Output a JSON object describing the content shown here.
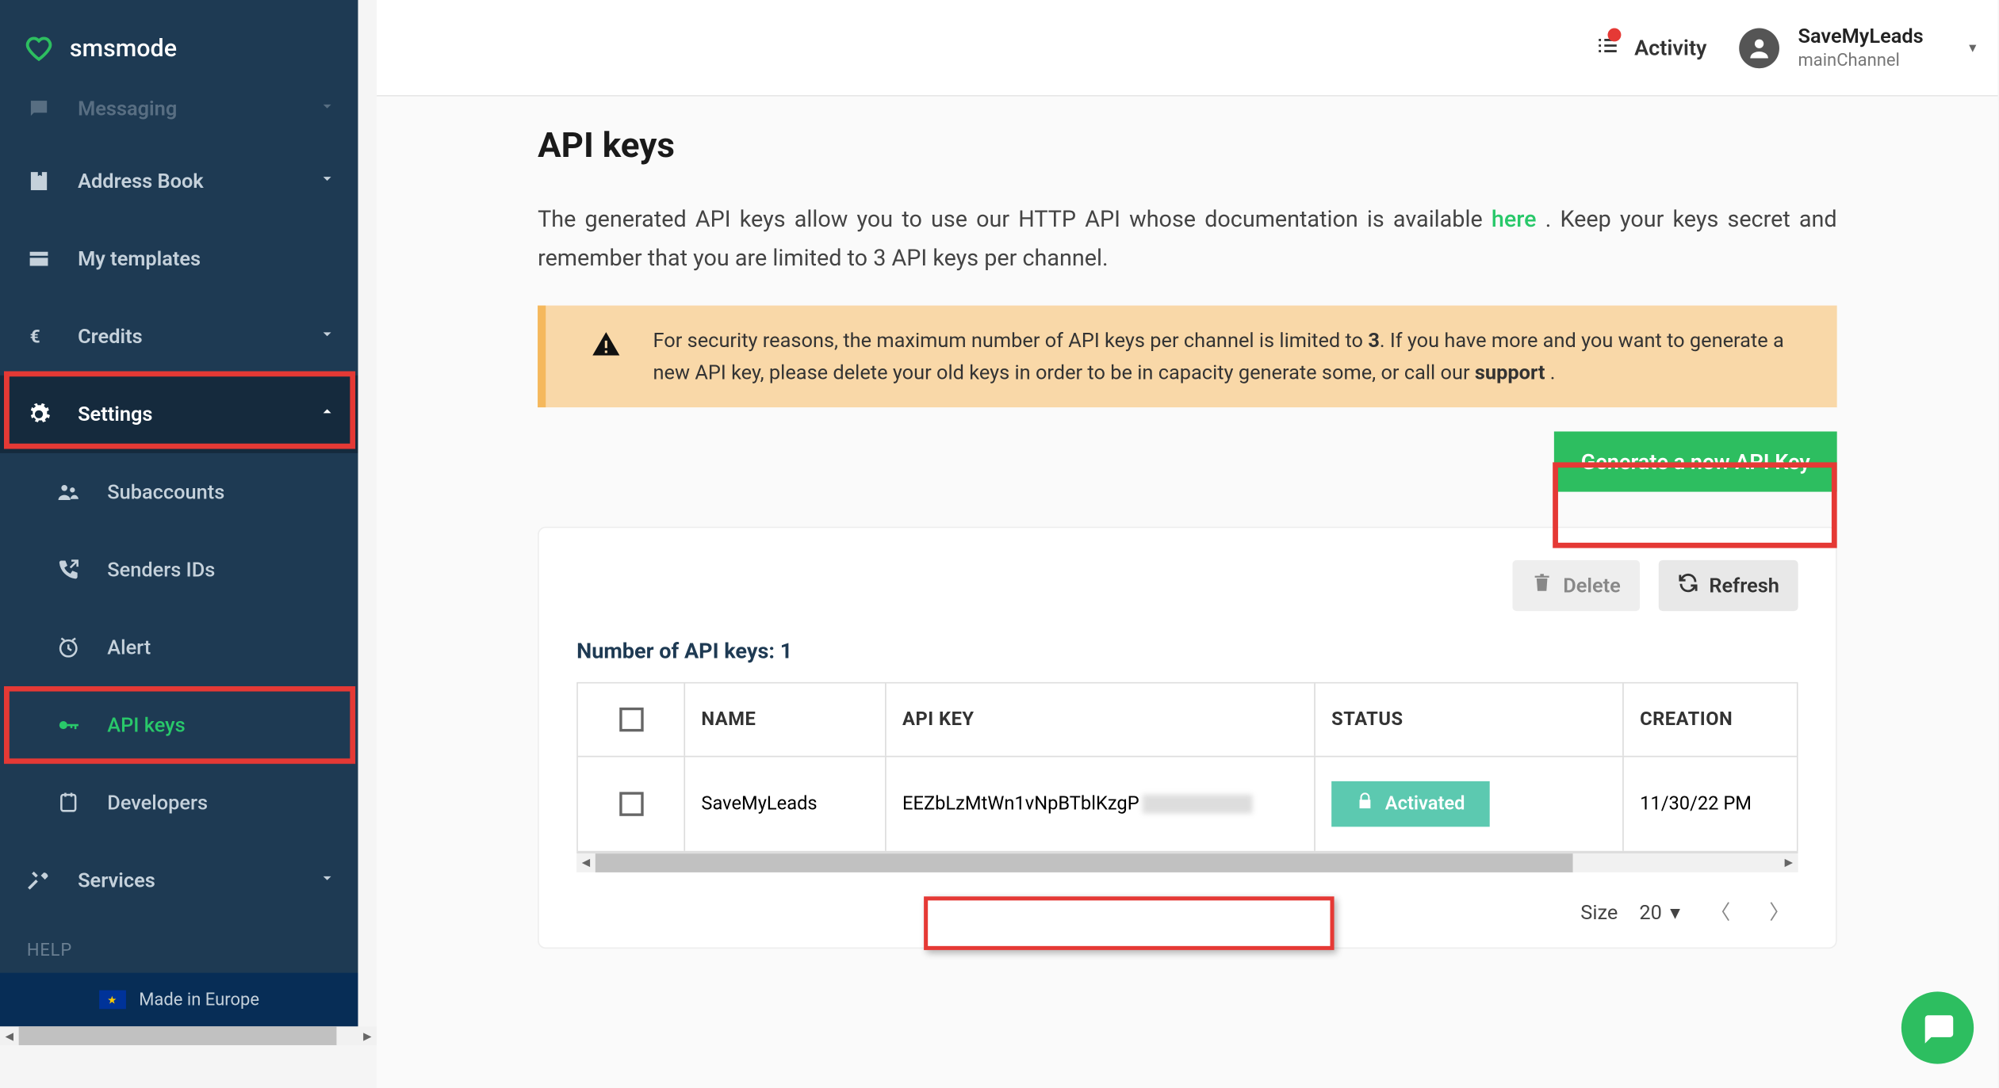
{
  "brand": "smsmode",
  "sidebar": {
    "messaging": "Messaging",
    "address_book": "Address Book",
    "my_templates": "My templates",
    "credits": "Credits",
    "settings": "Settings",
    "subaccounts": "Subaccounts",
    "senders_ids": "Senders IDs",
    "alert": "Alert",
    "api_keys": "API keys",
    "developers": "Developers",
    "services": "Services",
    "help": "HELP",
    "made_in_europe": "Made in Europe"
  },
  "header": {
    "activity": "Activity",
    "user_name": "SaveMyLeads",
    "user_channel": "mainChannel"
  },
  "page": {
    "title": "API keys",
    "desc_before": "The generated API keys allow you to use our HTTP API whose documentation is available ",
    "desc_link": "here",
    "desc_after": " . Keep your keys secret and remember that you are limited to 3 API keys per channel.",
    "warn_before": "For security reasons, the maximum number of API keys per channel is limited to ",
    "warn_bold1": "3",
    "warn_mid": ". If you have more and you want to generate a new API key, please delete your old keys in order to be in capacity generate some, or call our ",
    "warn_bold2": "support",
    "warn_after": " .",
    "gen_btn": "Generate a new API Key",
    "delete_btn": "Delete",
    "refresh_btn": "Refresh",
    "count_label": "Number of API keys: 1",
    "cols": {
      "name": "NAME",
      "api_key": "API KEY",
      "status": "STATUS",
      "creation": "CREATION"
    },
    "row": {
      "name": "SaveMyLeads",
      "api_key": "EEZbLzMtWn1vNpBTblKzgP",
      "status": "Activated",
      "creation": "11/30/22 PM"
    },
    "pager": {
      "size_label": "Size",
      "size_value": "20"
    }
  }
}
